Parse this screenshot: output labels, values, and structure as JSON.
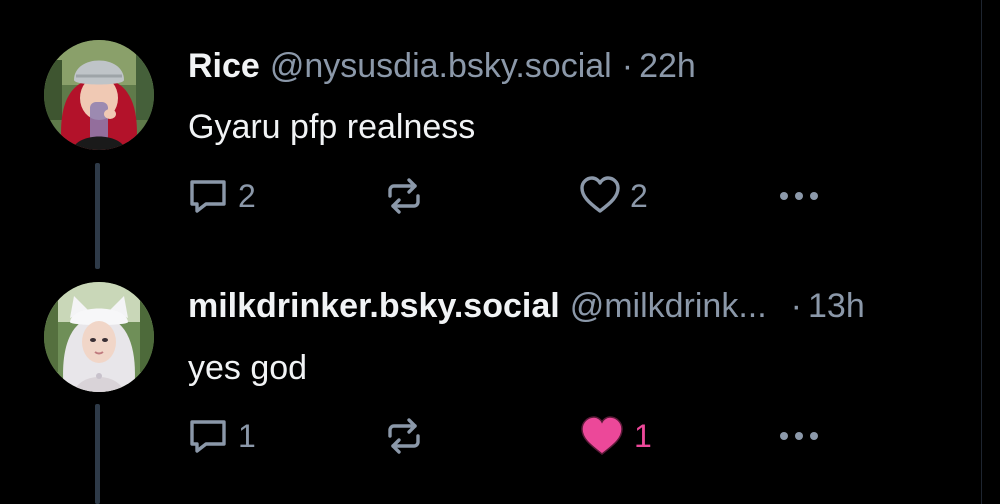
{
  "posts": [
    {
      "display_name": "Rice",
      "handle": "@nysusdia.bsky.social",
      "separator": "·",
      "time": "22h",
      "text": "Gyaru pfp realness",
      "reply_count": "2",
      "like_count": "2",
      "liked": false,
      "icons": [
        "reply-icon",
        "repost-icon",
        "heart-icon",
        "more-icon"
      ]
    },
    {
      "display_name": "milkdrinker.bsky.social",
      "handle": "@milkdrink...",
      "separator": "·",
      "time": "13h",
      "text": "yes god",
      "reply_count": "1",
      "like_count": "1",
      "liked": true,
      "icons": [
        "reply-icon",
        "repost-icon",
        "heart-filled-icon",
        "more-icon"
      ]
    }
  ],
  "colors": {
    "background": "#000000",
    "text": "#f1f3f5",
    "muted": "#8b98a9",
    "thread_line": "#2e3a48",
    "like_active": "#ec4899"
  }
}
